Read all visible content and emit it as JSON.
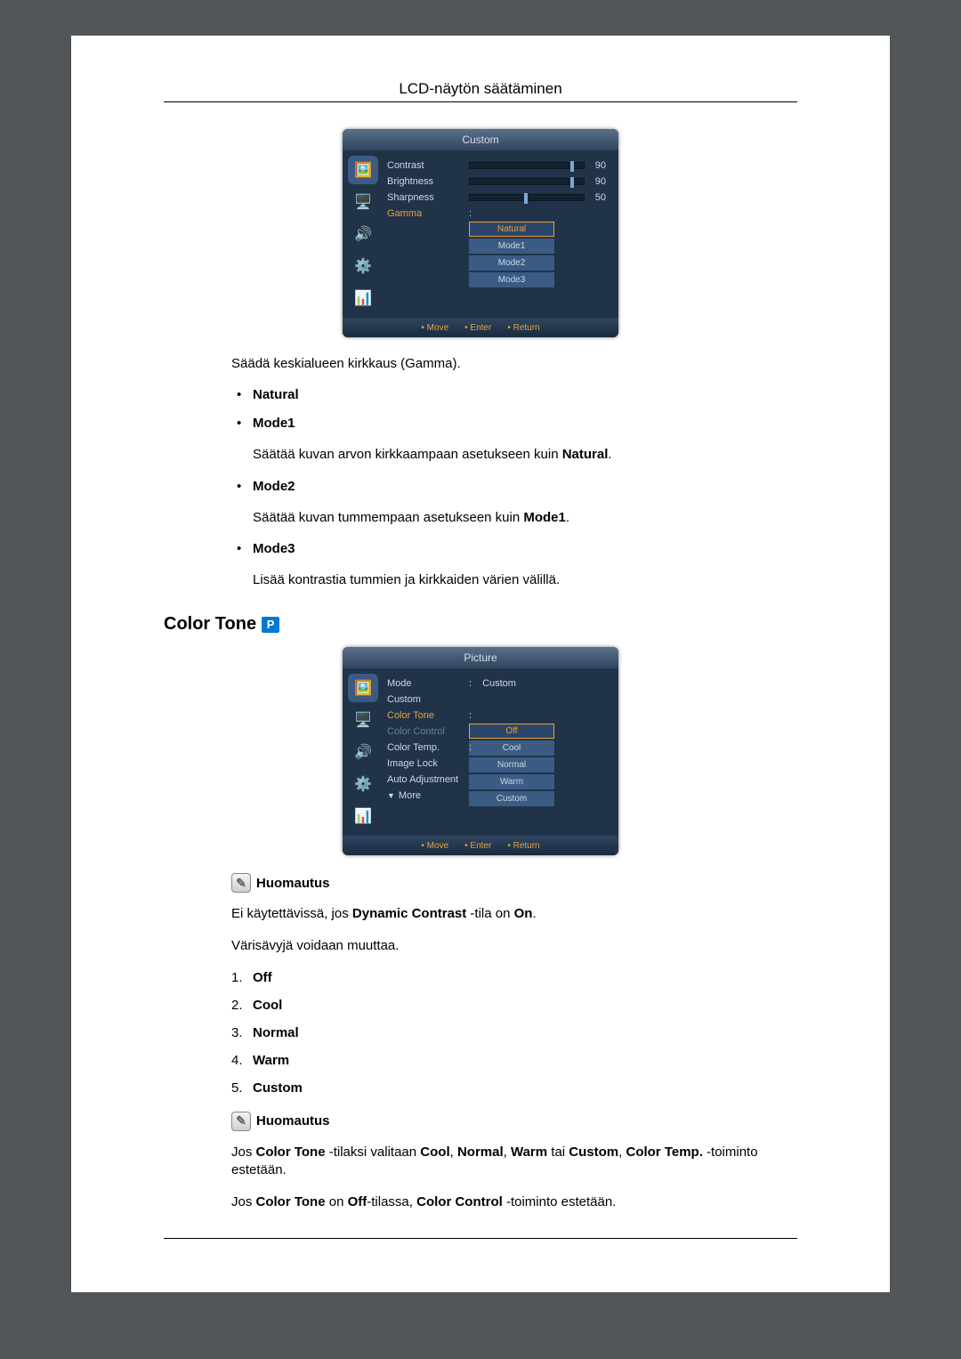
{
  "page_title": "LCD-näytön säätäminen",
  "osd1": {
    "header": "Custom",
    "rows": [
      {
        "label": "Contrast",
        "val": "90",
        "pos": 90
      },
      {
        "label": "Brightness",
        "val": "90",
        "pos": 90
      },
      {
        "label": "Sharpness",
        "val": "50",
        "pos": 50
      }
    ],
    "gamma_label": "Gamma",
    "options": [
      "Natural",
      "Mode1",
      "Mode2",
      "Mode3"
    ],
    "footer": {
      "move": "Move",
      "enter": "Enter",
      "return": "Return"
    }
  },
  "intro1": "Säädä keskialueen kirkkaus (Gamma).",
  "bullets": {
    "natural": "Natural",
    "mode1": {
      "title": "Mode1",
      "desc": [
        "Säätää kuvan arvon kirkkaampaan asetukseen kuin ",
        "Natural",
        "."
      ]
    },
    "mode2": {
      "title": "Mode2",
      "desc": [
        "Säätää kuvan tummempaan asetukseen kuin ",
        "Mode1",
        "."
      ]
    },
    "mode3": {
      "title": "Mode3",
      "desc": "Lisää kontrastia tummien ja kirkkaiden värien välillä."
    }
  },
  "section2_title": "Color Tone",
  "osd2": {
    "header": "Picture",
    "items": {
      "mode_label": "Mode",
      "mode_val": "Custom",
      "custom_label": "Custom",
      "colortone_label": "Color Tone",
      "colorcontrol_label": "Color Control",
      "colortemp_label": "Color Temp.",
      "imagelock_label": "Image Lock",
      "autoadj_label": "Auto Adjustment",
      "more_label": "More"
    },
    "options": [
      "Off",
      "Cool",
      "Normal",
      "Warm",
      "Custom"
    ],
    "footer": {
      "move": "Move",
      "enter": "Enter",
      "return": "Return"
    }
  },
  "note_label": "Huomautus",
  "note1_parts": [
    "Ei käytettävissä, jos ",
    "Dynamic Contrast",
    " -tila on ",
    "On",
    "."
  ],
  "para_change": "Värisävyjä voidaan muuttaa.",
  "numlist": [
    "Off",
    "Cool",
    "Normal",
    "Warm",
    "Custom"
  ],
  "note2_parts": [
    "Jos ",
    "Color Tone",
    " -tilaksi valitaan ",
    "Cool",
    ", ",
    "Normal",
    ", ",
    "Warm",
    " tai ",
    "Custom",
    ", ",
    "Color Temp.",
    " -toiminto estetään."
  ],
  "note3_parts": [
    "Jos ",
    "Color Tone",
    " on ",
    "Off",
    "-tilassa, ",
    "Color Control",
    " -toiminto estetään."
  ]
}
